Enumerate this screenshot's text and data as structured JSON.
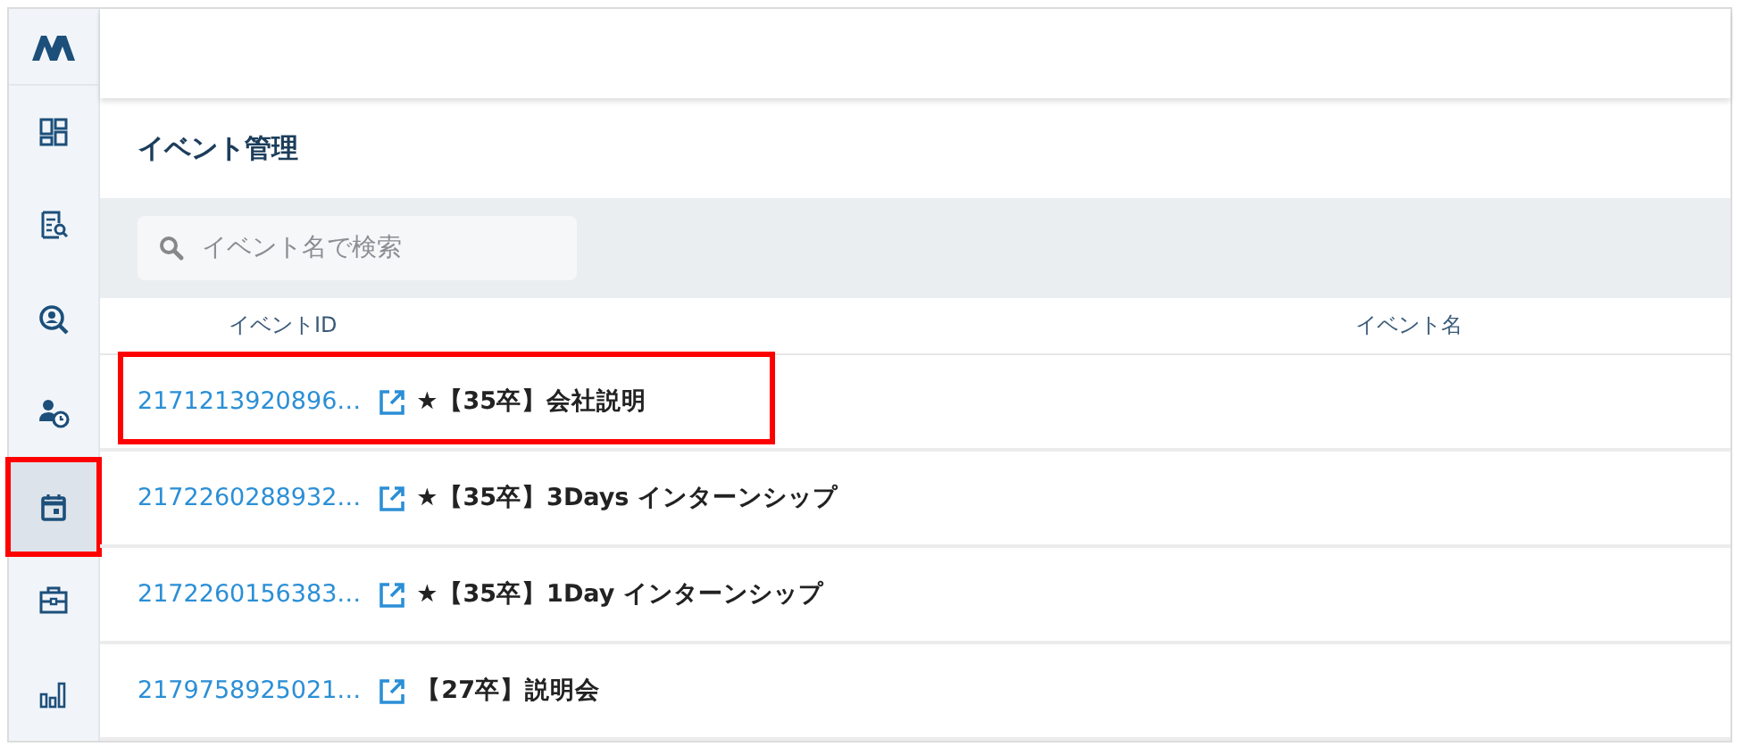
{
  "sidebar": {
    "items": [
      {
        "selected": false,
        "highlighted": false
      },
      {
        "selected": false,
        "highlighted": false
      },
      {
        "selected": false,
        "highlighted": false
      },
      {
        "selected": false,
        "highlighted": false
      },
      {
        "selected": true,
        "highlighted": true
      },
      {
        "selected": false,
        "highlighted": false
      },
      {
        "selected": false,
        "highlighted": false
      }
    ]
  },
  "page_title": "イベント管理",
  "search": {
    "placeholder": "イベント名で検索"
  },
  "table": {
    "columns": [
      "イベントID",
      "イベント名"
    ],
    "rows": [
      {
        "id": "2171213920896…",
        "name": "★【35卒】会社説明",
        "highlighted": true
      },
      {
        "id": "2172260288932…",
        "name": "★【35卒】3Days インターンシップ",
        "highlighted": false
      },
      {
        "id": "2172260156383…",
        "name": "★【35卒】1Day インターンシップ",
        "highlighted": false
      },
      {
        "id": "2179758925021…",
        "name": "【27卒】説明会",
        "highlighted": false
      }
    ]
  }
}
